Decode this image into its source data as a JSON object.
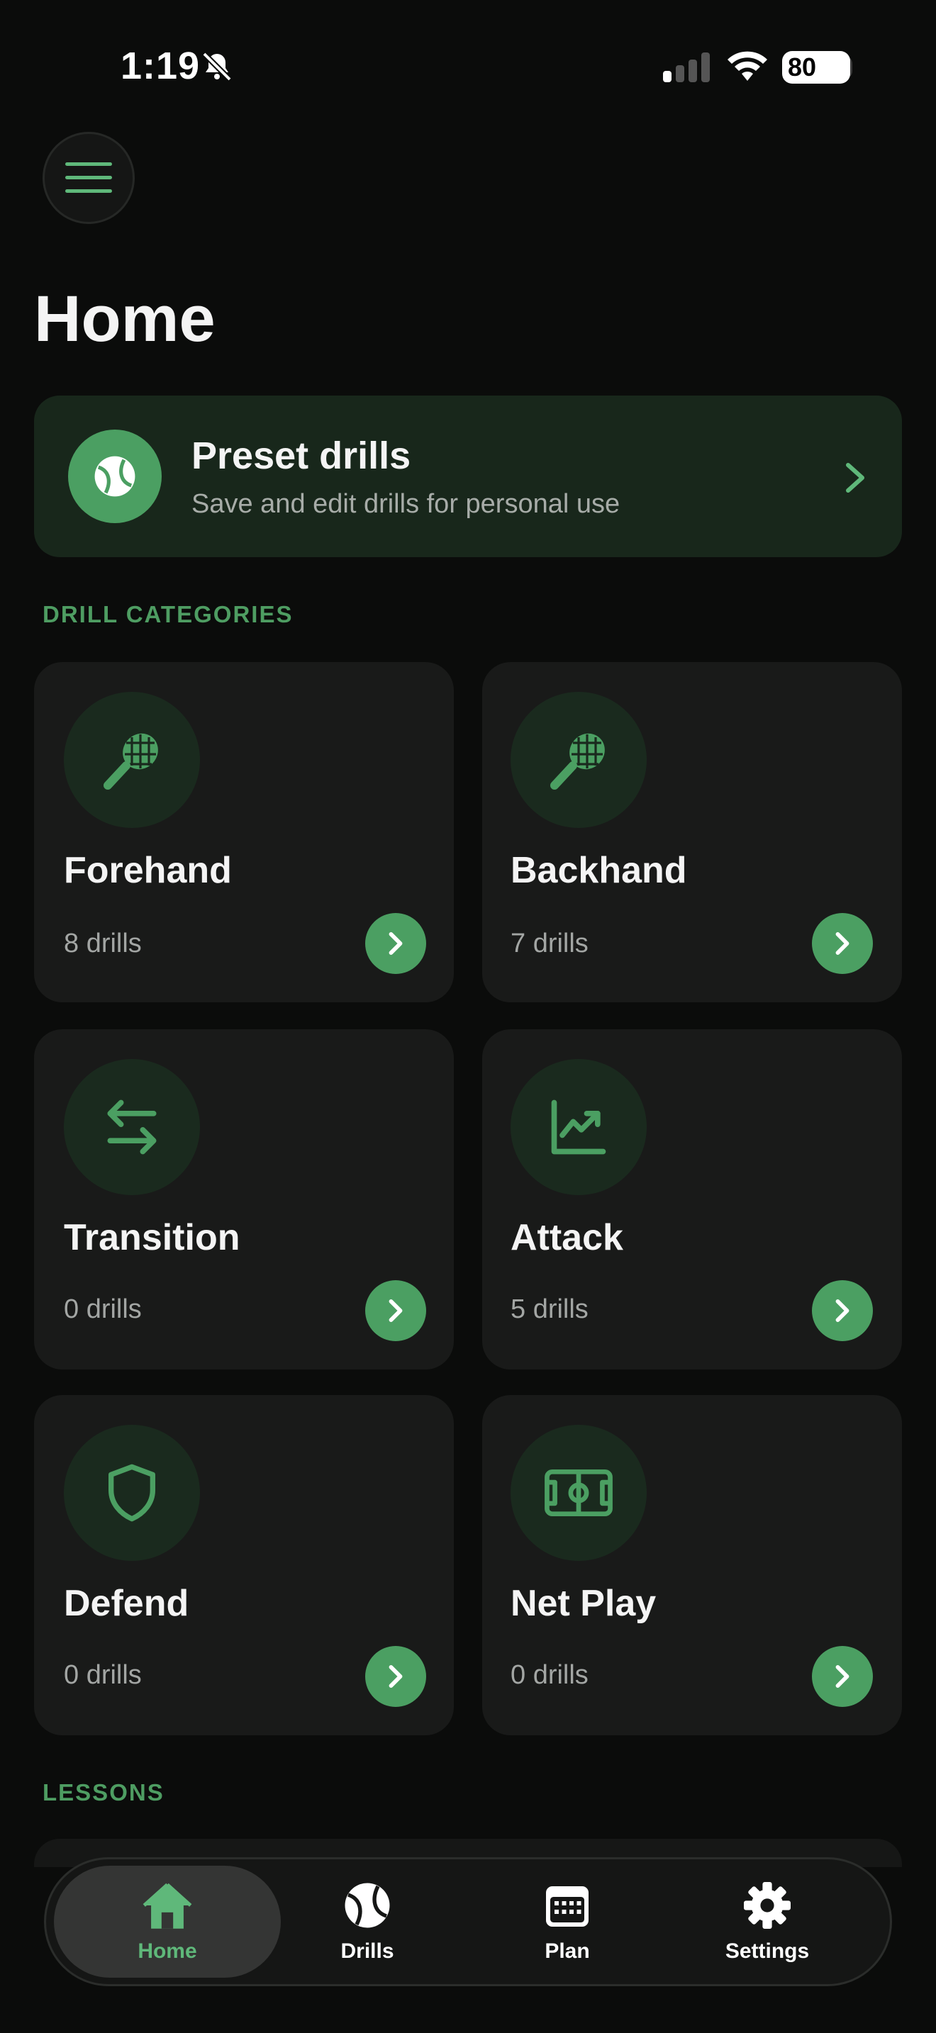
{
  "status_bar": {
    "time": "1:19",
    "battery": "80"
  },
  "header": {
    "title": "Home"
  },
  "preset": {
    "title": "Preset drills",
    "subtitle": "Save and edit drills for personal use"
  },
  "sections": {
    "categories": "DRILL CATEGORIES",
    "lessons": "LESSONS"
  },
  "categories": [
    {
      "title": "Forehand",
      "count": "8 drills",
      "icon": "tennis-racket-icon"
    },
    {
      "title": "Backhand",
      "count": "7 drills",
      "icon": "tennis-racket-icon"
    },
    {
      "title": "Transition",
      "count": "0 drills",
      "icon": "arrows-exchange-icon"
    },
    {
      "title": "Attack",
      "count": "5 drills",
      "icon": "trend-chart-icon"
    },
    {
      "title": "Defend",
      "count": "0 drills",
      "icon": "shield-icon"
    },
    {
      "title": "Net Play",
      "count": "0 drills",
      "icon": "court-icon"
    }
  ],
  "tabs": [
    {
      "label": "Home",
      "icon": "home-icon",
      "active": true
    },
    {
      "label": "Drills",
      "icon": "tennis-ball-icon"
    },
    {
      "label": "Plan",
      "icon": "calendar-icon"
    },
    {
      "label": "Settings",
      "icon": "gear-icon"
    }
  ],
  "colors": {
    "accent": "#4b9f62",
    "background": "#0b0c0b",
    "card": "#191a19"
  }
}
